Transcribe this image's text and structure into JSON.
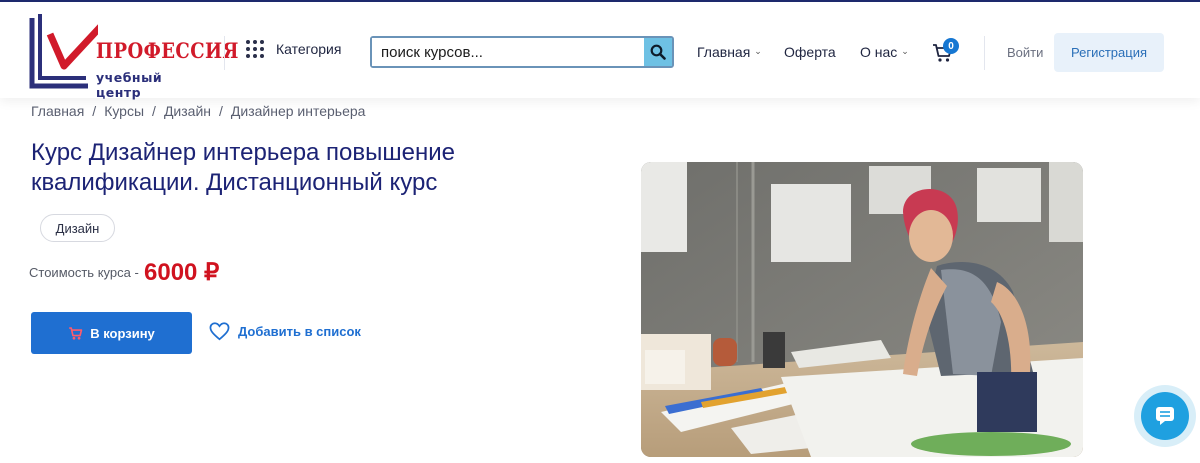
{
  "header": {
    "logo": {
      "title": "ПРОФЕССИЯ",
      "subtitle": "учебный центр"
    },
    "category_label": "Категория",
    "search": {
      "placeholder": "поиск курсов..."
    },
    "nav": [
      {
        "label": "Главная",
        "has_dropdown": true
      },
      {
        "label": "Оферта",
        "has_dropdown": false
      },
      {
        "label": "О нас",
        "has_dropdown": true
      }
    ],
    "cart_count": "0",
    "login_label": "Войти",
    "register_label": "Регистрация"
  },
  "breadcrumb": [
    "Главная",
    "Курсы",
    "Дизайн",
    "Дизайнер интерьера"
  ],
  "course": {
    "title": "Курс Дизайнер интерьера повышение квалификации. Дистанционный курс",
    "tag": "Дизайн",
    "price_label": "Стоимость курса -",
    "price": "6000 ₽",
    "add_to_cart_label": "В корзину",
    "wishlist_label": "Добавить в список"
  },
  "colors": {
    "accent": "#1f6fd1",
    "price": "#d0121f",
    "title": "#1c2375",
    "logo_red": "#d11a2a",
    "logo_navy": "#2b2f7a"
  },
  "icons": [
    "logo-checkmark-icon",
    "category-grid-icon",
    "search-icon",
    "chevron-down-icon",
    "cart-icon",
    "heart-icon",
    "chat-icon"
  ]
}
